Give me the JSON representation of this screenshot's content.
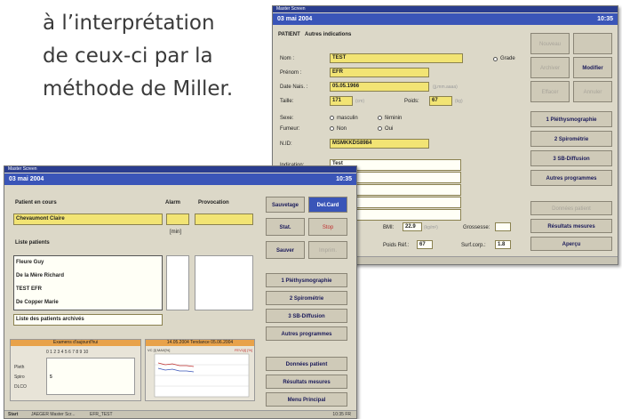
{
  "caption": {
    "line1": "à l’interprétation",
    "line2": "de ceux-ci par la",
    "line3": "méthode de Miller."
  },
  "back_window": {
    "title": "Master Screen",
    "date": "03 mai 2004",
    "time": "10:35",
    "tab_label": "PATIENT",
    "tab_other": "Autres indications",
    "nom_label": "Nom :",
    "nom_value": "TEST",
    "prenom_label": "Prénom :",
    "prenom_value": "EFR",
    "date_naiss_label": "Date Nais. :",
    "date_naiss_value": "05.05.1966",
    "date_naiss_hint": "(jj.mm.aaaa)",
    "taille_label": "Taille:",
    "taille_value": "171",
    "taille_unit": "(cm)",
    "poids_label": "Poids:",
    "poids_value": "67",
    "poids_unit": "(kg)",
    "grade_label": "Grade",
    "sexe_label": "Sexe:",
    "sexe_opt1": "masculin",
    "sexe_opt2": "féminin",
    "fumeur_label": "Fumeur:",
    "fumeur_opt1": "Non",
    "fumeur_opt2": "Oui",
    "nid_label": "N.ID:",
    "nid_value": "MSMKKDS8984",
    "indication_label": "Indication:",
    "indication_value": "Test",
    "bmi_label": "BMI:",
    "bmi_value": "22.9",
    "bmi_unit": "(kg/m²)",
    "grossesse_label": "Grossesse:",
    "poids_ref_label": "Poids Réf.:",
    "poids_ref_value": "67",
    "surf_corp_label": "Surf.corp.:",
    "surf_corp_value": "1.8",
    "top_buttons": [
      "Nouveau",
      "",
      "Archiver",
      "Modifier",
      "Effacer",
      "Annuler"
    ],
    "prog_buttons": [
      "1 Pléthysmographie",
      "2 Spirométrie",
      "3 SB-Diffusion",
      "Autres programmes"
    ],
    "bottom_buttons": [
      "Données patient",
      "Résultats mesures",
      "Aperçu"
    ]
  },
  "front_window": {
    "title": "Master Screen",
    "date": "03 mai 2004",
    "time": "10:35",
    "patient_en_cours_label": "Patient en cours",
    "alarm_label": "Alarm",
    "provocation_label": "Provocation",
    "current_patient": "Chevaumont Claire",
    "min_label": "[min]",
    "liste_patients_label": "Liste patients",
    "patients": [
      "Fleure Guy",
      "De la Mère Richard",
      "TEST EFR",
      "De Copper Marie"
    ],
    "archived_label": "Liste des patients archivés",
    "side_buttons_top": [
      "Sauvetage",
      "Del.Card",
      "Stat.",
      "Stop",
      "Sauver",
      "Imprim."
    ],
    "prog_buttons": [
      "1 Pléthysmographie",
      "2 Spirométrie",
      "3 SB-Diffusion",
      "Autres programmes"
    ],
    "bottom_buttons": [
      "Données patient",
      "Résultats mesures",
      "Menu Principal"
    ],
    "panel_left": {
      "header": "Examens d'aujourd'hui",
      "numbers": "0 1 2 3 4 5 6 7 8 9 10",
      "rows": [
        "Pleth",
        "Spiro",
        "DLCO"
      ],
      "mark": "5"
    },
    "panel_right": {
      "header": "14.05.2004   Tendance   05.06.2004",
      "left_axis_label": "VC [l] MAX[%]",
      "right_axis_label": "FEV1[l] [%]"
    },
    "status": {
      "left1": "Start",
      "left2": "JAEGER Master Scr...",
      "left3": "EFR_TEST",
      "right": "10:35  FR"
    }
  }
}
